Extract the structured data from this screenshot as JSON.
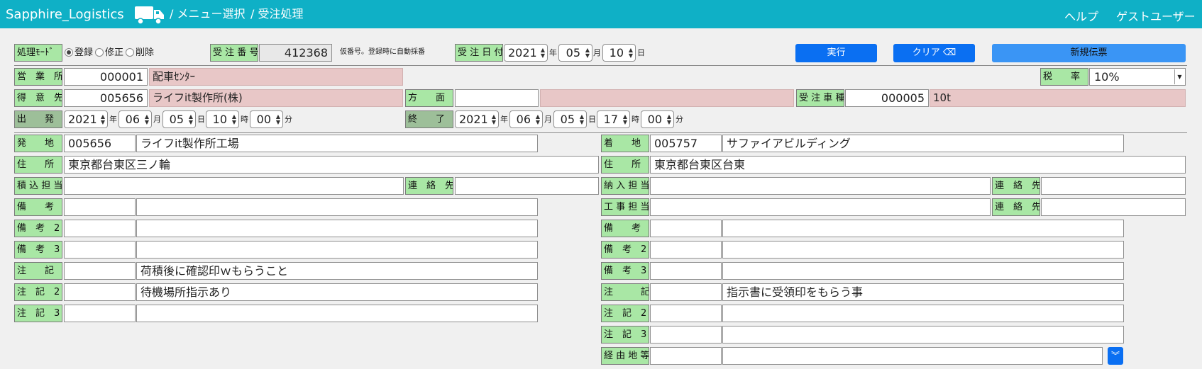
{
  "header": {
    "brand": "Sapphire_Logistics",
    "crumb1": "/ メニュー選択",
    "crumb2": "/ 受注処理",
    "help": "ヘルプ",
    "user": "ゲストユーザー",
    "truck_icon": "truck-icon"
  },
  "mode": {
    "label": "処理ﾓｰﾄﾞ",
    "options": [
      "登録",
      "修正",
      "削除"
    ],
    "selected": "登録"
  },
  "order_no": {
    "label": "受 注 番 号",
    "value": "412368",
    "note": "仮番号。登録時に自動採番"
  },
  "order_date": {
    "label": "受 注 日 付",
    "year": "2021",
    "month": "05",
    "day": "10",
    "u_year": "年",
    "u_month": "月",
    "u_day": "日"
  },
  "buttons": {
    "execute": "実行",
    "clear": "クリア",
    "new": "新規伝票"
  },
  "office": {
    "label": "営　業　所",
    "code": "000001",
    "name": "配車ｾﾝﾀｰ"
  },
  "tax": {
    "label": "税　　率",
    "value": "10%"
  },
  "customer": {
    "label": "得　意　先",
    "code": "005656",
    "name": "ライフit製作所(株)"
  },
  "direction": {
    "label": "方　　面",
    "value": ""
  },
  "vehicle": {
    "label": "受 注 車 種",
    "code": "000005",
    "name": "10t"
  },
  "depart": {
    "label": "出　　発",
    "year": "2021",
    "month": "06",
    "day": "05",
    "hour": "10",
    "min": "00"
  },
  "end": {
    "label": "終　　了",
    "year": "2021",
    "month": "06",
    "day": "05",
    "hour": "17",
    "min": "00"
  },
  "units": {
    "year": "年",
    "month": "月",
    "day": "日",
    "hour": "時",
    "min": "分"
  },
  "origin": {
    "place_label": "発　　地",
    "place_code": "005656",
    "place_name": "ライフit製作所工場",
    "addr_label": "住　　所",
    "addr": "東京都台東区三ノ輪",
    "staff_label": "積 込 担 当",
    "contact_label": "連　絡　先",
    "remarks": [
      {
        "label": "備　　考",
        "code": "",
        "text": ""
      },
      {
        "label": "備　考　2",
        "code": "",
        "text": ""
      },
      {
        "label": "備　考　3",
        "code": "",
        "text": ""
      },
      {
        "label": "注　　記",
        "code": "",
        "text": "荷積後に確認印ｗもらうこと"
      },
      {
        "label": "注　記　2",
        "code": "",
        "text": "待機場所指示あり"
      },
      {
        "label": "注　記　3",
        "code": "",
        "text": ""
      }
    ]
  },
  "dest": {
    "place_label": "着　　地",
    "place_code": "005757",
    "place_name": "サファイアビルディング",
    "addr_label": "住　　所",
    "addr": "東京都台東区台東",
    "staff_label": "納 入 担 当",
    "contact_label": "連　絡　先",
    "work_label": "工 事 担 当",
    "contact2_label": "連　絡　先",
    "remarks": [
      {
        "label": "備　　考",
        "code": "",
        "text": ""
      },
      {
        "label": "備　考　2",
        "code": "",
        "text": ""
      },
      {
        "label": "備　考　3",
        "code": "",
        "text": ""
      },
      {
        "label": "注　　　記",
        "code": "",
        "text": "指示書に受領印をもらう事"
      },
      {
        "label": "注　記　2",
        "code": "",
        "text": ""
      },
      {
        "label": "注　記　3",
        "code": "",
        "text": ""
      },
      {
        "label": "経 由 地 等",
        "code": "",
        "text": ""
      }
    ]
  },
  "colors": {
    "header": "#0fb0c6",
    "label_green": "#a9e7a5",
    "pink": "#e8c7c7",
    "button_blue": "#0a6ff2"
  }
}
